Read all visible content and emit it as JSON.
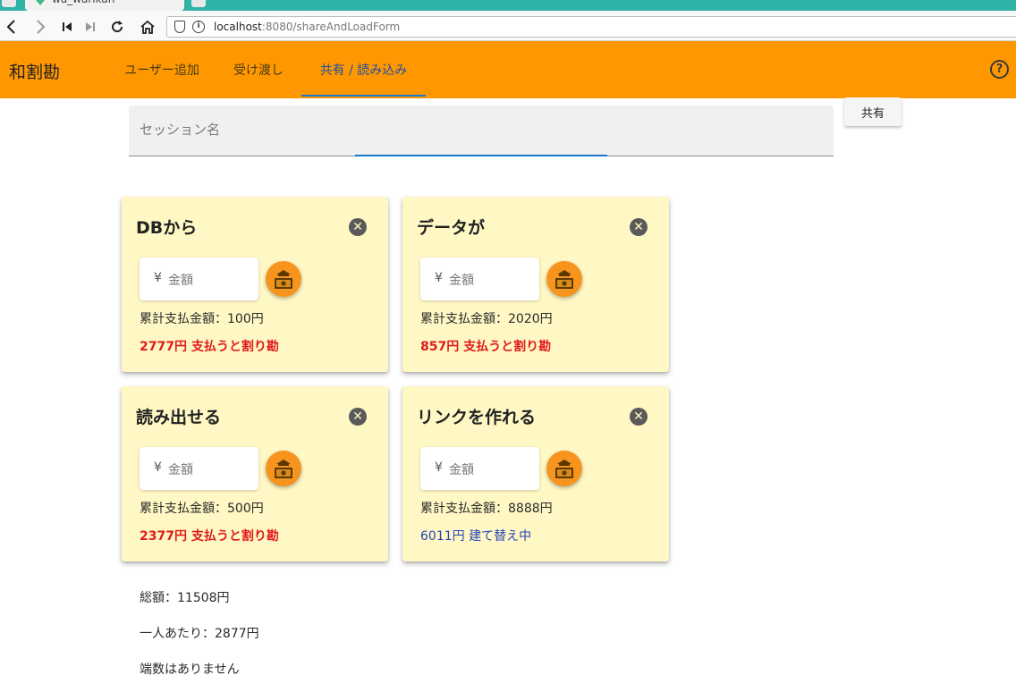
{
  "browser": {
    "tab_title": "wa_warikan",
    "url_host": "localhost",
    "url_rest": ":8080/shareAndLoadForm"
  },
  "app": {
    "title": "和割勘",
    "tabs": [
      {
        "label": "ユーザー追加",
        "active": false
      },
      {
        "label": "受け渡し",
        "active": false
      },
      {
        "label": "共有 / 読み込み",
        "active": true
      }
    ],
    "help_icon": "?",
    "accent_color": "#ff9800"
  },
  "session": {
    "label": "セッション名",
    "value": "",
    "share_label": "共有"
  },
  "users": [
    {
      "name": "DBから",
      "yen": "¥",
      "amount_placeholder": "金額",
      "paid": "累計支払金額：100円",
      "status": "2777円 支払うと割り勘",
      "status_type": "pay"
    },
    {
      "name": "データが",
      "yen": "¥",
      "amount_placeholder": "金額",
      "paid": "累計支払金額：2020円",
      "status": "857円 支払うと割り勘",
      "status_type": "pay"
    },
    {
      "name": "読み出せる",
      "yen": "¥",
      "amount_placeholder": "金額",
      "paid": "累計支払金額：500円",
      "status": "2377円 支払うと割り勘",
      "status_type": "pay"
    },
    {
      "name": "リンクを作れる",
      "yen": "¥",
      "amount_placeholder": "金額",
      "paid": "累計支払金額：8888円",
      "status": "6011円 建て替え中",
      "status_type": "rebuild"
    }
  ],
  "summary": {
    "total": "総額：11508円",
    "per_person": "一人あたり：2877円",
    "remainder": "端数はありません"
  },
  "icons": {
    "close": "close-icon",
    "pay": "money-icon"
  }
}
